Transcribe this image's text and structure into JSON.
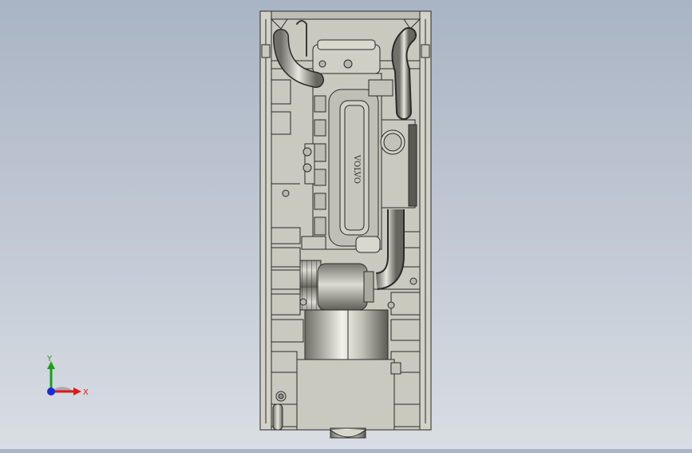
{
  "viewport": {
    "model_name": "engine-generator-top-view",
    "engine_badge_text": "VOLVO"
  },
  "triad": {
    "x_label": "X",
    "y_label": "Y",
    "colors": {
      "x": "#e01818",
      "y": "#1aa01a",
      "z": "#1a2ad8"
    }
  },
  "colors": {
    "background_top": "#a9b4c4",
    "background_bottom": "#d9dde4",
    "metal": "#c9c9bf",
    "outline": "#2a2a2a"
  }
}
